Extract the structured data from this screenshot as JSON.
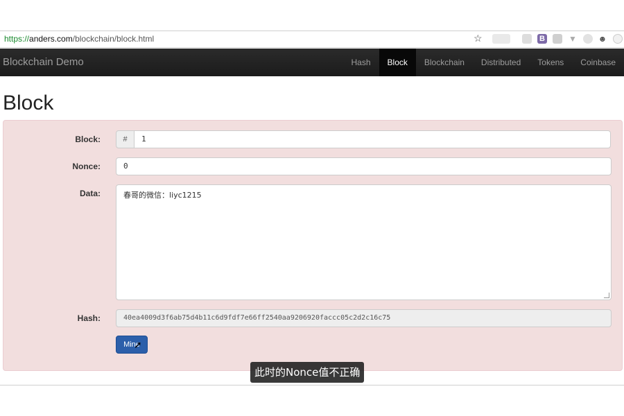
{
  "browser": {
    "url_scheme": "https://",
    "url_host": "anders.com",
    "url_path": "/blockchain/block.html",
    "bookmark_icon": "star-icon",
    "extensions": [
      "extension-icon",
      "extension-icon",
      "bitly-icon",
      "extension-icon",
      "vpn-icon",
      "extension-icon",
      "ghost-icon",
      "power-icon"
    ],
    "ext_b_label": "B"
  },
  "navbar": {
    "brand": "Blockchain Demo",
    "items": [
      {
        "label": "Hash",
        "active": false
      },
      {
        "label": "Block",
        "active": true
      },
      {
        "label": "Blockchain",
        "active": false
      },
      {
        "label": "Distributed",
        "active": false
      },
      {
        "label": "Tokens",
        "active": false
      },
      {
        "label": "Coinbase",
        "active": false
      }
    ]
  },
  "page": {
    "title": "Block"
  },
  "form": {
    "block_label": "Block:",
    "block_addon": "#",
    "block_value": "1",
    "nonce_label": "Nonce:",
    "nonce_value": "0",
    "data_label": "Data:",
    "data_value": "春哥的微信：liyc1215",
    "hash_label": "Hash:",
    "hash_value": "40ea4009d3f6ab75d4b11c6d9fdf7e66ff2540aa9206920faccc05c2d2c16c75",
    "mine_label": "Mine",
    "panel_color": "#f2dede"
  },
  "caption": {
    "text": "此时的Nonce值不正确"
  }
}
